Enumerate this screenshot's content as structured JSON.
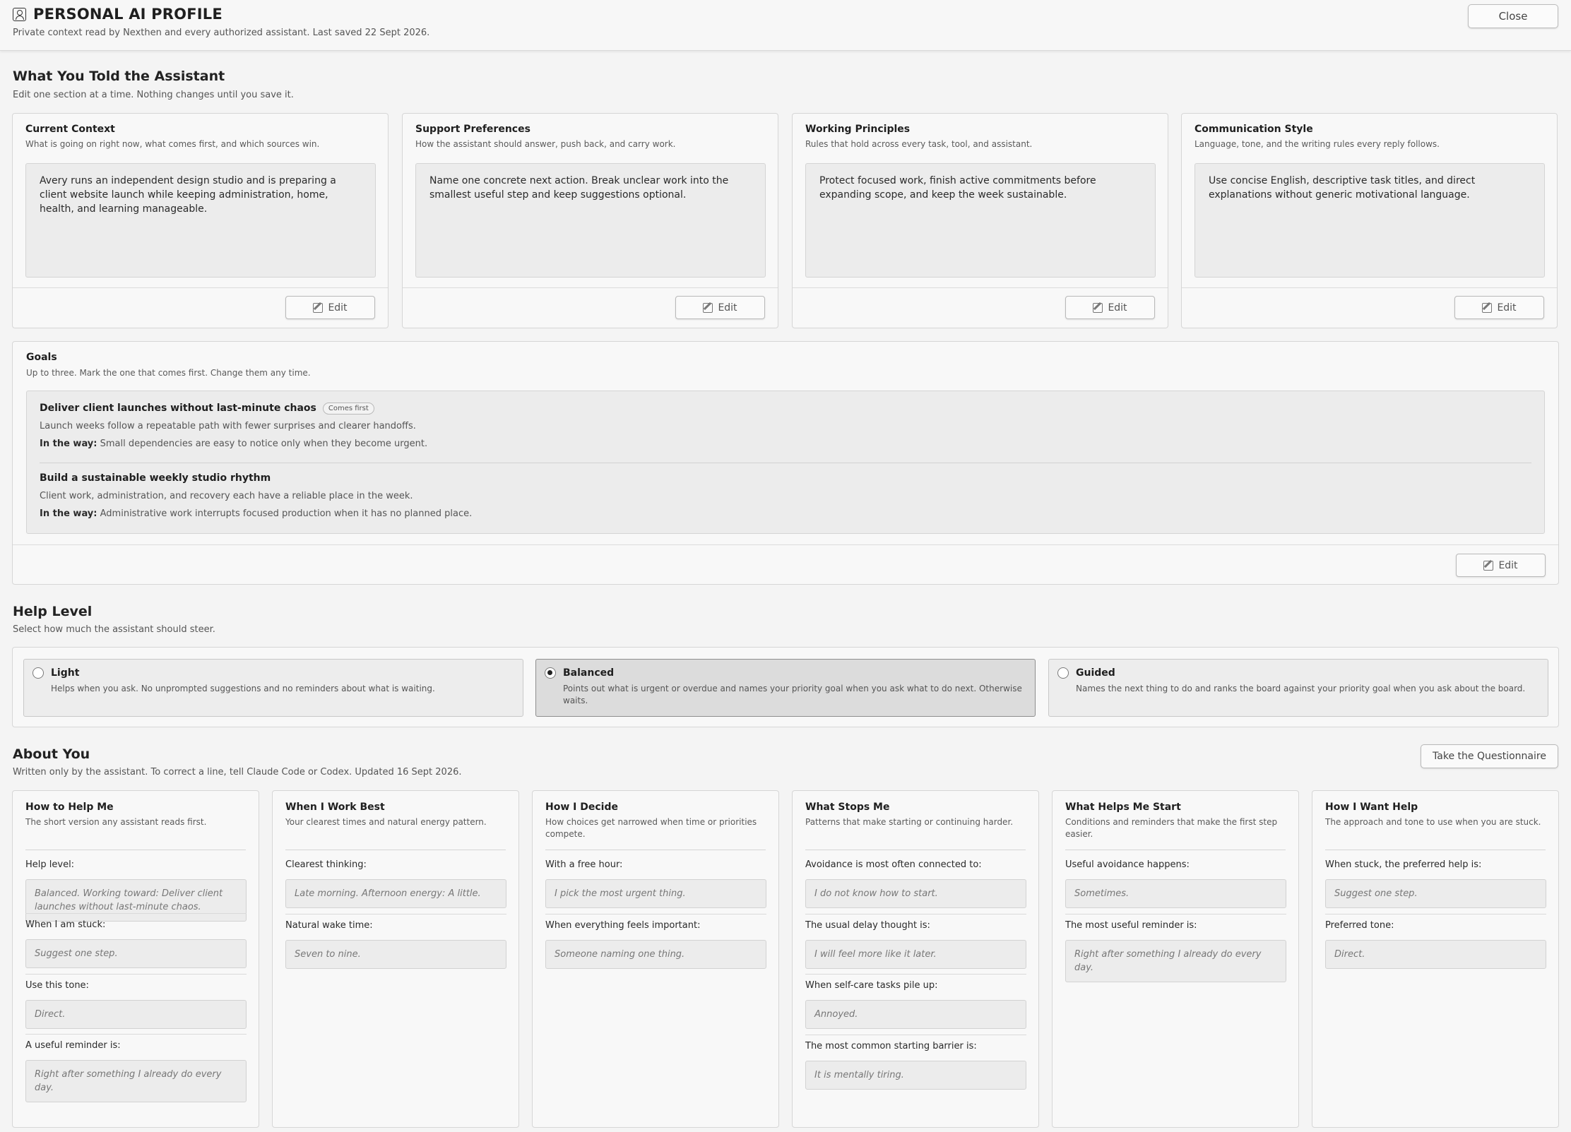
{
  "header": {
    "title": "PERSONAL AI PROFILE",
    "subtitle": "Private context read by Nexthen and every authorized assistant. Last saved 22 Sept 2026.",
    "close_label": "Close"
  },
  "told": {
    "title": "What You Told the Assistant",
    "subtitle": "Edit one section at a time. Nothing changes until you save it.",
    "edit_label": "Edit",
    "cards": [
      {
        "title": "Current Context",
        "desc": "What is going on right now, what comes first, and which sources win.",
        "body": "Avery runs an independent design studio and is preparing a client website launch while keeping administration, home, health, and learning manageable."
      },
      {
        "title": "Support Preferences",
        "desc": "How the assistant should answer, push back, and carry work.",
        "body": "Name one concrete next action. Break unclear work into the smallest useful step and keep suggestions optional."
      },
      {
        "title": "Working Principles",
        "desc": "Rules that hold across every task, tool, and assistant.",
        "body": "Protect focused work, finish active commitments before expanding scope, and keep the week sustainable."
      },
      {
        "title": "Communication Style",
        "desc": "Language, tone, and the writing rules every reply follows.",
        "body": "Use concise English, descriptive task titles, and direct explanations without generic motivational language."
      }
    ],
    "goals": {
      "title": "Goals",
      "desc": "Up to three. Mark the one that comes first. Change them any time.",
      "in_the_way_label": "In the way:",
      "items": [
        {
          "title": "Deliver client launches without last-minute chaos",
          "badge": "Comes first",
          "desc": "Launch weeks follow a repeatable path with fewer surprises and clearer handoffs.",
          "in_the_way": "Small dependencies are easy to notice only when they become urgent."
        },
        {
          "title": "Build a sustainable weekly studio rhythm",
          "badge": "",
          "desc": "Client work, administration, and recovery each have a reliable place in the week.",
          "in_the_way": "Administrative work interrupts focused production when it has no planned place."
        }
      ]
    }
  },
  "help_level": {
    "title": "Help Level",
    "subtitle": "Select how much the assistant should steer.",
    "options": [
      {
        "label": "Light",
        "desc": "Helps when you ask. No unprompted suggestions and no reminders about what is waiting.",
        "selected": false
      },
      {
        "label": "Balanced",
        "desc": "Points out what is urgent or overdue and names your priority goal when you ask what to do next. Otherwise waits.",
        "selected": true
      },
      {
        "label": "Guided",
        "desc": "Names the next thing to do and ranks the board against your priority goal when you ask about the board.",
        "selected": false
      }
    ]
  },
  "about": {
    "title": "About You",
    "subtitle": "Written only by the assistant. To correct a line, tell Claude Code or Codex. Updated 16 Sept 2026.",
    "questionnaire_label": "Take the Questionnaire",
    "cards": [
      {
        "title": "How to Help Me",
        "desc": "The short version any assistant reads first.",
        "items": [
          {
            "q": "Help level:",
            "a": "Balanced. Working toward: Deliver client launches without last-minute chaos."
          },
          {
            "q": "When I am stuck:",
            "a": "Suggest one step."
          },
          {
            "q": "Use this tone:",
            "a": "Direct."
          },
          {
            "q": "A useful reminder is:",
            "a": "Right after something I already do every day."
          }
        ]
      },
      {
        "title": "When I Work Best",
        "desc": "Your clearest times and natural energy pattern.",
        "items": [
          {
            "q": "Clearest thinking:",
            "a": "Late morning. Afternoon energy: A little."
          },
          {
            "q": "Natural wake time:",
            "a": "Seven to nine."
          }
        ]
      },
      {
        "title": "How I Decide",
        "desc": "How choices get narrowed when time or priorities compete.",
        "items": [
          {
            "q": "With a free hour:",
            "a": "I pick the most urgent thing."
          },
          {
            "q": "When everything feels important:",
            "a": "Someone naming one thing."
          }
        ]
      },
      {
        "title": "What Stops Me",
        "desc": "Patterns that make starting or continuing harder.",
        "items": [
          {
            "q": "Avoidance is most often connected to:",
            "a": "I do not know how to start."
          },
          {
            "q": "The usual delay thought is:",
            "a": "I will feel more like it later."
          },
          {
            "q": "When self-care tasks pile up:",
            "a": "Annoyed."
          },
          {
            "q": "The most common starting barrier is:",
            "a": "It is mentally tiring."
          }
        ]
      },
      {
        "title": "What Helps Me Start",
        "desc": "Conditions and reminders that make the first step easier.",
        "items": [
          {
            "q": "Useful avoidance happens:",
            "a": "Sometimes."
          },
          {
            "q": "The most useful reminder is:",
            "a": "Right after something I already do every day."
          }
        ]
      },
      {
        "title": "How I Want Help",
        "desc": "The approach and tone to use when you are stuck.",
        "items": [
          {
            "q": "When stuck, the preferred help is:",
            "a": "Suggest one step."
          },
          {
            "q": "Preferred tone:",
            "a": "Direct."
          }
        ]
      }
    ]
  }
}
